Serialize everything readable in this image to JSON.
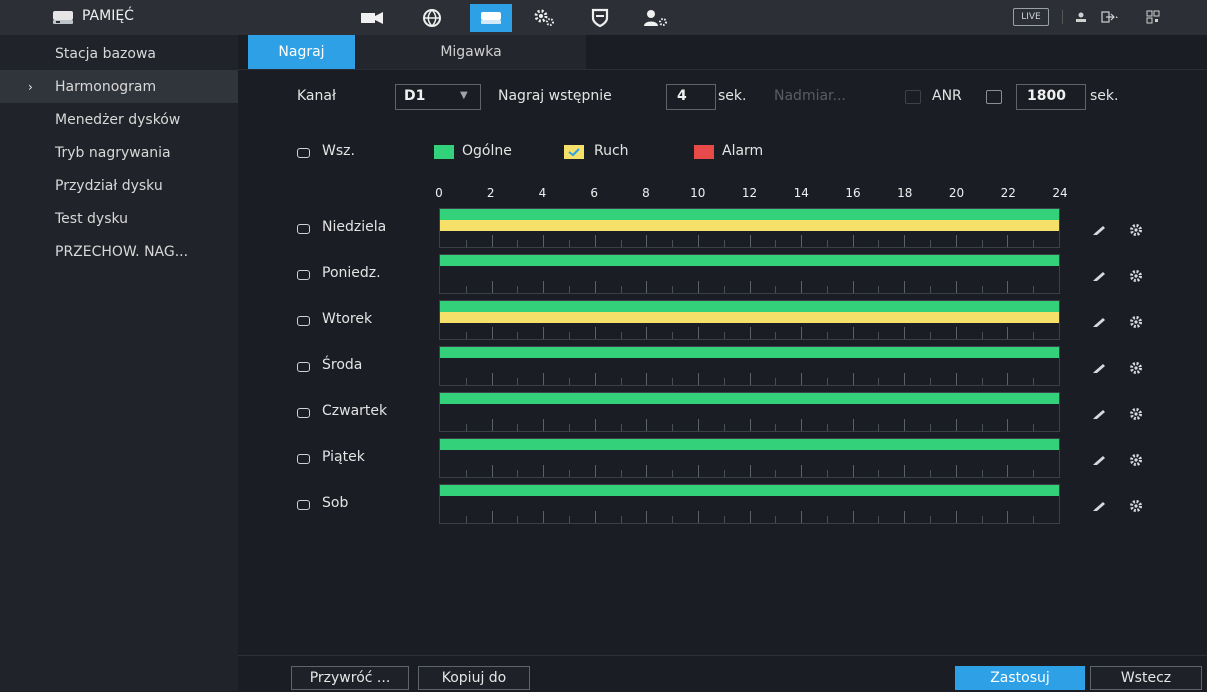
{
  "header": {
    "title": "PAMIĘĆ",
    "app_icon": "hdd-icon",
    "nav_icons": [
      "camera-icon",
      "network-globe-icon",
      "storage-icon",
      "system-gears-icon",
      "security-shield-icon",
      "account-gear-icon"
    ],
    "live_label": "LIVE",
    "right_icons": [
      "user-icon",
      "logout-icon",
      "qr-icon"
    ]
  },
  "sidebar": {
    "items": [
      {
        "label": "Stacja bazowa"
      },
      {
        "label": "Harmonogram",
        "active": true
      },
      {
        "label": "Menedżer dysków"
      },
      {
        "label": "Tryb nagrywania"
      },
      {
        "label": "Przydział dysku"
      },
      {
        "label": "Test dysku"
      },
      {
        "label": "PRZECHOW. NAG..."
      }
    ]
  },
  "tabs": [
    {
      "label": "Nagraj",
      "active": true
    },
    {
      "label": "Migawka"
    }
  ],
  "settings": {
    "channel_label": "Kanał",
    "channel_value": "D1",
    "prerecord_label": "Nagraj wstępnie",
    "prerecord_value": "4",
    "prerecord_unit": "sek.",
    "redundancy_label": "Nadmiar...",
    "anr_label": "ANR",
    "anr_value": "1800",
    "anr_unit": "sek."
  },
  "legend": {
    "all_label": "Wsz.",
    "items": [
      {
        "label": "Ogólne",
        "color": "#33d17a"
      },
      {
        "label": "Ruch",
        "color": "#f5e06a"
      },
      {
        "label": "Alarm",
        "color": "#e84a4a"
      }
    ]
  },
  "hours": [
    "0",
    "2",
    "4",
    "6",
    "8",
    "10",
    "12",
    "14",
    "16",
    "18",
    "20",
    "22",
    "24"
  ],
  "days": [
    {
      "label": "Niedziela",
      "general": true,
      "motion": true
    },
    {
      "label": "Poniedz.",
      "general": true,
      "motion": false
    },
    {
      "label": "Wtorek",
      "general": true,
      "motion": true
    },
    {
      "label": "Środa",
      "general": true,
      "motion": false
    },
    {
      "label": "Czwartek",
      "general": true,
      "motion": false
    },
    {
      "label": "Piątek",
      "general": true,
      "motion": false
    },
    {
      "label": "Sob",
      "general": true,
      "motion": false
    }
  ],
  "row_icons": [
    "pencil-icon",
    "gear-icon"
  ],
  "buttons": {
    "restore": "Przywróć ...",
    "copy": "Kopiuj do",
    "apply": "Zastosuj",
    "back": "Wstecz"
  }
}
